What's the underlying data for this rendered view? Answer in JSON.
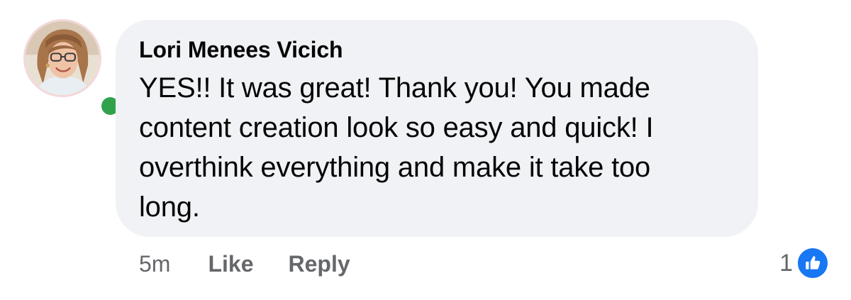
{
  "comment": {
    "author": "Lori Menees Vicich",
    "text": "YES!! It was great!  Thank you! You made\ncontent creation look so easy and quick! I\noverthink everything and make it take too\nlong.",
    "timestamp": "5m",
    "like_label": "Like",
    "reply_label": "Reply",
    "reaction_count": "1",
    "reaction_icon": "thumbs-up-icon",
    "online_status_icon": "online-dot",
    "colors": {
      "bubble": "#f0f2f5",
      "online": "#31a24c",
      "like_badge": "#1877f2",
      "meta_text": "#65676b"
    }
  }
}
